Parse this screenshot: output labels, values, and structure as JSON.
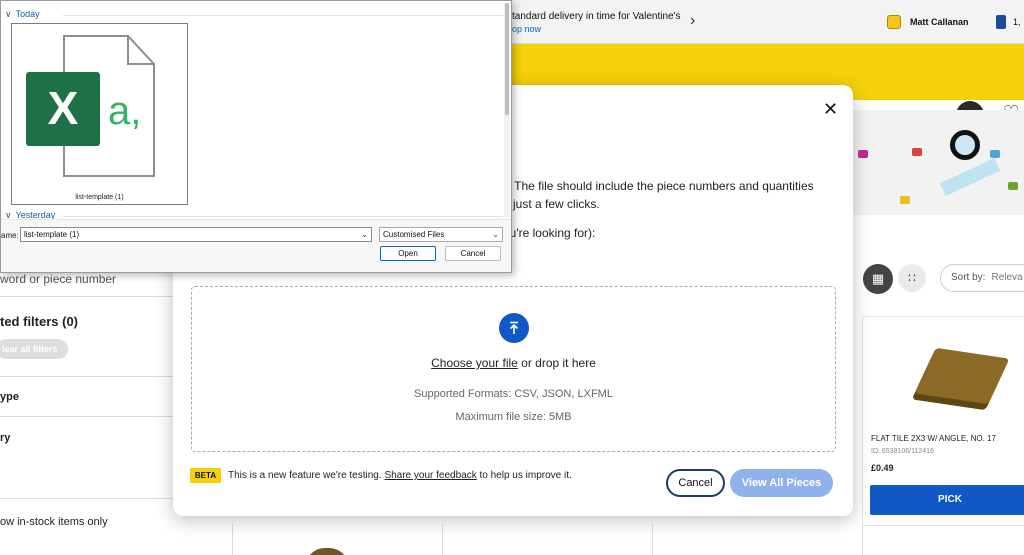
{
  "header": {
    "promo_line1": "tandard delivery in time for Valentine's",
    "promo_line2": "op now",
    "user_name": "Matt Callanan",
    "vip_points": "1,"
  },
  "sidebar": {
    "search_placeholder": "word or piece number",
    "applied_filters": "ted filters (0)",
    "clear_all": "lear all filters",
    "filter_type": "ype",
    "filter_colour": "ry",
    "in_stock": "ow in-stock items only"
  },
  "results": {
    "sort_label": "Sort by:",
    "sort_value": "Releva",
    "product": {
      "name": "FLAT TILE 2X3 W/ ANGLE, NO. 17",
      "id": "ID: 6538106/112416",
      "price": "£0.49",
      "pick_label": "PICK"
    }
  },
  "modal": {
    "desc_line1": "re. The file should include the piece numbers and quantities",
    "desc_line2": "ith just a few clicks.",
    "desc_line3": "you're looking for):",
    "choose_file": "Choose your file",
    "or_drop": " or drop it here",
    "formats": "Supported Formats:  CSV, JSON, LXFML",
    "max_size": "Maximum file size:  5MB",
    "beta_badge": "BETA",
    "beta_text_pre": "This is a new feature we're testing. ",
    "beta_link": "Share your feedback",
    "beta_text_post": " to help us improve it.",
    "cancel_label": "Cancel",
    "view_all_label": "View All Pieces",
    "accent_color": "#1158c7"
  },
  "file_dialog": {
    "group_today": "Today",
    "group_yesterday": "Yesterday",
    "tile_file_name": "list-template (1)",
    "file_name_label": "ame:",
    "file_name_value": "list-template (1)",
    "file_type_value": "Customised Files",
    "open_label": "Open",
    "cancel_label": "Cancel",
    "excel_letter": "X",
    "csv_glyph": "a,"
  }
}
